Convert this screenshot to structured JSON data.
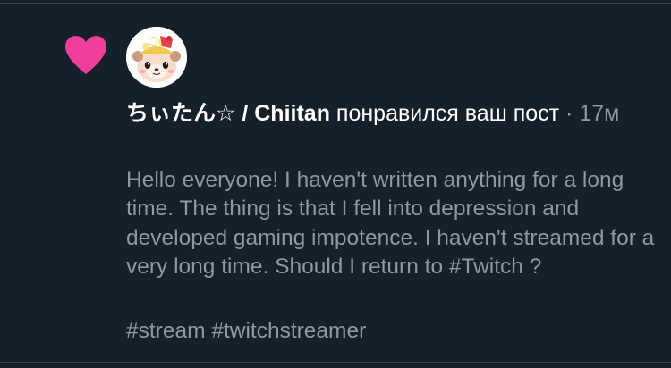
{
  "notification": {
    "display_name": "ちぃたん☆ / Chiitan",
    "action": "понравился ваш пост",
    "separator": "·",
    "time_ago": "17м",
    "post_text": "Hello everyone! I haven't written anything for a long time. The thing is that I fell into depression and developed gaming impotence. I haven't streamed for a very long time. Should I return to #Twitch ?",
    "hashtags": [
      "#stream",
      "#twitchstreamer"
    ]
  },
  "colors": {
    "background": "#15202b",
    "heart": "#f03e9b",
    "primary_text": "#ffffff",
    "secondary_text": "#8b98a5",
    "divider": "#38444d"
  },
  "icons": {
    "like": "heart-icon",
    "avatar": "chiitan-avatar"
  }
}
